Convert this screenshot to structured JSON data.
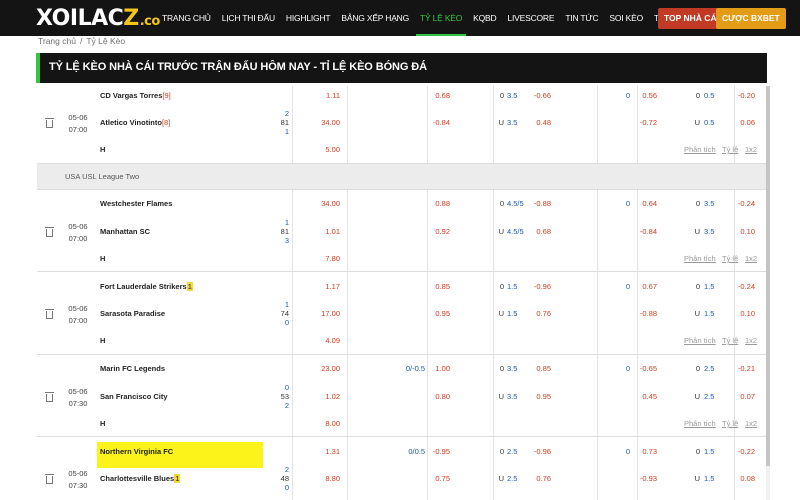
{
  "logo": {
    "main": "XOILAC",
    "z": "Z",
    "suffix": ".co"
  },
  "nav": [
    "TRANG CHỦ",
    "LỊCH THI ĐẤU",
    "HIGHLIGHT",
    "BẢNG XẾP HẠNG",
    "TỶ LỆ KÈO",
    "KQBD",
    "LIVESCORE",
    "TIN TỨC",
    "SOI KÈO",
    "TUYỂN DỤNG"
  ],
  "nav_active_index": 4,
  "header_buttons": {
    "top_nha_cai": "TOP NHÀ CÁI",
    "cuoc_bxbet": "CƯỢC BXBET"
  },
  "breadcrumb": {
    "home": "Trang chủ",
    "sep": "/",
    "current": "Tỷ Lệ Kèo"
  },
  "page_title": "TỶ LỆ KÈO NHÀ CÁI TRƯỚC TRẬN ĐẤU HÔM NAY - TỈ LỆ KÈO BÓNG ĐÁ",
  "colors": {
    "accent": "#33c444",
    "red": "#d23b1e",
    "blue": "#1b59ad",
    "highlight": "#fbf31a",
    "bar": "#141414"
  },
  "links": {
    "analysis": "Phân tích",
    "odds": "Tỷ lệ",
    "one_x_two": "1x2"
  },
  "league_usl": "USA USL League Two",
  "matches": [
    {
      "date": "05-06",
      "time": "07:00",
      "home": "CD Vargas Torres",
      "home_card": "[9]",
      "away": "Atletico Vinotinto",
      "away_card": "[8]",
      "draw_label": "H",
      "ft_1x2": {
        "home": "1.11",
        "away": "34.00",
        "draw": "5.00"
      },
      "stat": {
        "home": "2",
        "mid": "81",
        "away": "1"
      },
      "ah_line_home": "",
      "ah_line_away": "",
      "ah": {
        "home": "0.68",
        "away": "-0.84"
      },
      "ou": {
        "line_home": "3.5",
        "line_away": "3.5",
        "prefix_home": "0",
        "prefix_away": "U",
        "home": "-0.66",
        "away": "0.48"
      },
      "h1_ah": {
        "line": "0",
        "home": "0.56",
        "away": "-0.72"
      },
      "h1_ou": {
        "prefix_home": "0",
        "line_home": "0.5",
        "prefix_away": "U",
        "line_away": "0.5",
        "home": "-0.20",
        "away": "0.06"
      }
    },
    {
      "date": "05-06",
      "time": "07:00",
      "home": "Westchester Flames",
      "home_card": "",
      "away": "Manhattan SC",
      "away_card": "",
      "draw_label": "H",
      "ft_1x2": {
        "home": "34.00",
        "away": "1.01",
        "draw": "7.80"
      },
      "stat": {
        "home": "1",
        "mid": "81",
        "away": "3"
      },
      "ah_line_home": "",
      "ah_line_away": "",
      "ah": {
        "home": "0.88",
        "away": "0.92"
      },
      "ou": {
        "line_home": "4.5/5",
        "line_away": "4.5/5",
        "prefix_home": "0",
        "prefix_away": "U",
        "home": "-0.88",
        "away": "0.68"
      },
      "h1_ah": {
        "line": "0",
        "home": "0.64",
        "away": "-0.84"
      },
      "h1_ou": {
        "prefix_home": "0",
        "line_home": "3.5",
        "prefix_away": "U",
        "line_away": "3.5",
        "home": "-0.24",
        "away": "0.10"
      }
    },
    {
      "date": "05-06",
      "time": "07:00",
      "home": "Fort Lauderdale Strikers",
      "home_card": "1",
      "away": "Sarasota Paradise",
      "away_card": "",
      "draw_label": "H",
      "ft_1x2": {
        "home": "1.17",
        "away": "17.00",
        "draw": "4.09"
      },
      "stat": {
        "home": "1",
        "mid": "74",
        "away": "0"
      },
      "ah_line_home": "",
      "ah_line_away": "",
      "ah": {
        "home": "0.85",
        "away": "0.95"
      },
      "ou": {
        "line_home": "1.5",
        "line_away": "1.5",
        "prefix_home": "0",
        "prefix_away": "U",
        "home": "-0.96",
        "away": "0.76"
      },
      "h1_ah": {
        "line": "0",
        "home": "0.67",
        "away": "-0.88"
      },
      "h1_ou": {
        "prefix_home": "0",
        "line_home": "1.5",
        "prefix_away": "U",
        "line_away": "1.5",
        "home": "-0.24",
        "away": "0.10"
      }
    },
    {
      "date": "05-06",
      "time": "07:30",
      "home": "Marin FC Legends",
      "home_card": "",
      "away": "San Francisco City",
      "away_card": "",
      "draw_label": "H",
      "ft_1x2": {
        "home": "23.00",
        "away": "1.02",
        "draw": "8.00"
      },
      "stat": {
        "home": "0",
        "mid": "53",
        "away": "2"
      },
      "ah_line_home": "0/-0.5",
      "ah_line_away": "",
      "ah": {
        "home": "1.00",
        "away": "0.80"
      },
      "ou": {
        "line_home": "3.5",
        "line_away": "3.5",
        "prefix_home": "0",
        "prefix_away": "U",
        "home": "0.85",
        "away": "0.95"
      },
      "h1_ah": {
        "line": "0",
        "home": "-0.65",
        "away": "0.45"
      },
      "h1_ou": {
        "prefix_home": "0",
        "line_home": "2.5",
        "prefix_away": "U",
        "line_away": "2.5",
        "home": "-0.21",
        "away": "0.07"
      }
    },
    {
      "date": "05-06",
      "time": "07:30",
      "home": "Northern Virginia FC",
      "home_card": "",
      "away": "Charlottesville Blues",
      "away_card": "1",
      "draw_label": "",
      "ft_1x2": {
        "home": "1.31",
        "away": "8.80",
        "draw": ""
      },
      "stat": {
        "home": "2",
        "mid": "48",
        "away": "0"
      },
      "ah_line_home": "0/0.5",
      "ah_line_away": "",
      "ah": {
        "home": "-0.95",
        "away": "0.75"
      },
      "ou": {
        "line_home": "2.5",
        "line_away": "2.5",
        "prefix_home": "0",
        "prefix_away": "U",
        "home": "-0.96",
        "away": "0.76"
      },
      "h1_ah": {
        "line": "0",
        "home": "0.73",
        "away": "-0.93"
      },
      "h1_ou": {
        "prefix_home": "0",
        "line_home": "1.5",
        "prefix_away": "U",
        "line_away": "1.5",
        "home": "-0.22",
        "away": "0.08"
      }
    }
  ]
}
